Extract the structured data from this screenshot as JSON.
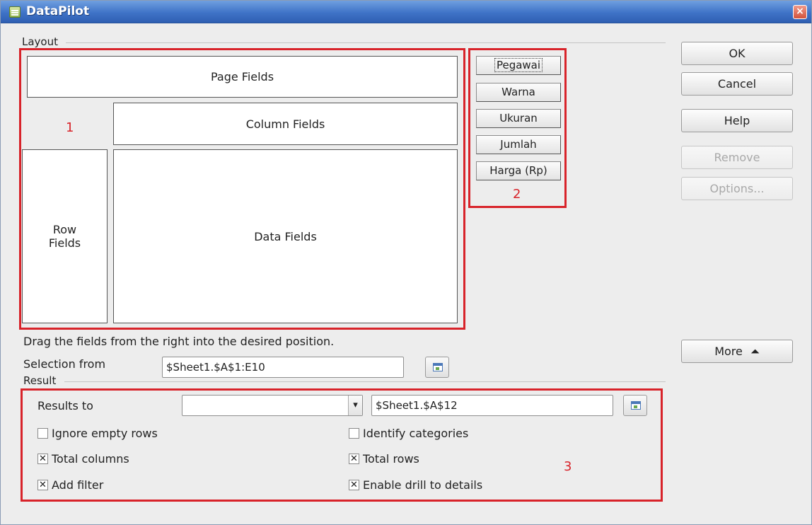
{
  "window": {
    "title": "DataPilot",
    "close_glyph": "×"
  },
  "layout": {
    "group_label": "Layout",
    "page_fields": "Page Fields",
    "column_fields": "Column Fields",
    "row_fields_line1": "Row",
    "row_fields_line2": "Fields",
    "data_fields": "Data Fields",
    "hint": "Drag the fields from the right into the desired position."
  },
  "fields": [
    {
      "label": "Pegawai",
      "focused": true
    },
    {
      "label": "Warna",
      "focused": false
    },
    {
      "label": "Ukuran",
      "focused": false
    },
    {
      "label": "Jumlah",
      "focused": false
    },
    {
      "label": "Harga (Rp)",
      "focused": false
    }
  ],
  "annotations": {
    "one": "1",
    "two": "2",
    "three": "3"
  },
  "buttons": {
    "ok": "OK",
    "cancel": "Cancel",
    "help": "Help",
    "remove": "Remove",
    "options": "Options...",
    "more": "More",
    "more_glyph": "⏶"
  },
  "selection": {
    "label": "Selection from",
    "value": "$Sheet1.$A$1:E10"
  },
  "result": {
    "group_label": "Result",
    "results_to_label": "Results to",
    "results_to_select": "",
    "results_to_value": "$Sheet1.$A$12",
    "dropdown_glyph": "▾"
  },
  "options": {
    "ignore_empty_rows": {
      "label": "Ignore empty rows",
      "checked": false
    },
    "identify_categories": {
      "label": "Identify categories",
      "checked": false
    },
    "total_columns": {
      "label": "Total columns",
      "checked": true
    },
    "total_rows": {
      "label": "Total rows",
      "checked": true
    },
    "add_filter": {
      "label": "Add filter",
      "checked": true
    },
    "enable_drill": {
      "label": "Enable drill to details",
      "checked": true
    }
  },
  "colors": {
    "annotation_red": "#d8232a",
    "titlebar_blue": "#3f73c7"
  }
}
